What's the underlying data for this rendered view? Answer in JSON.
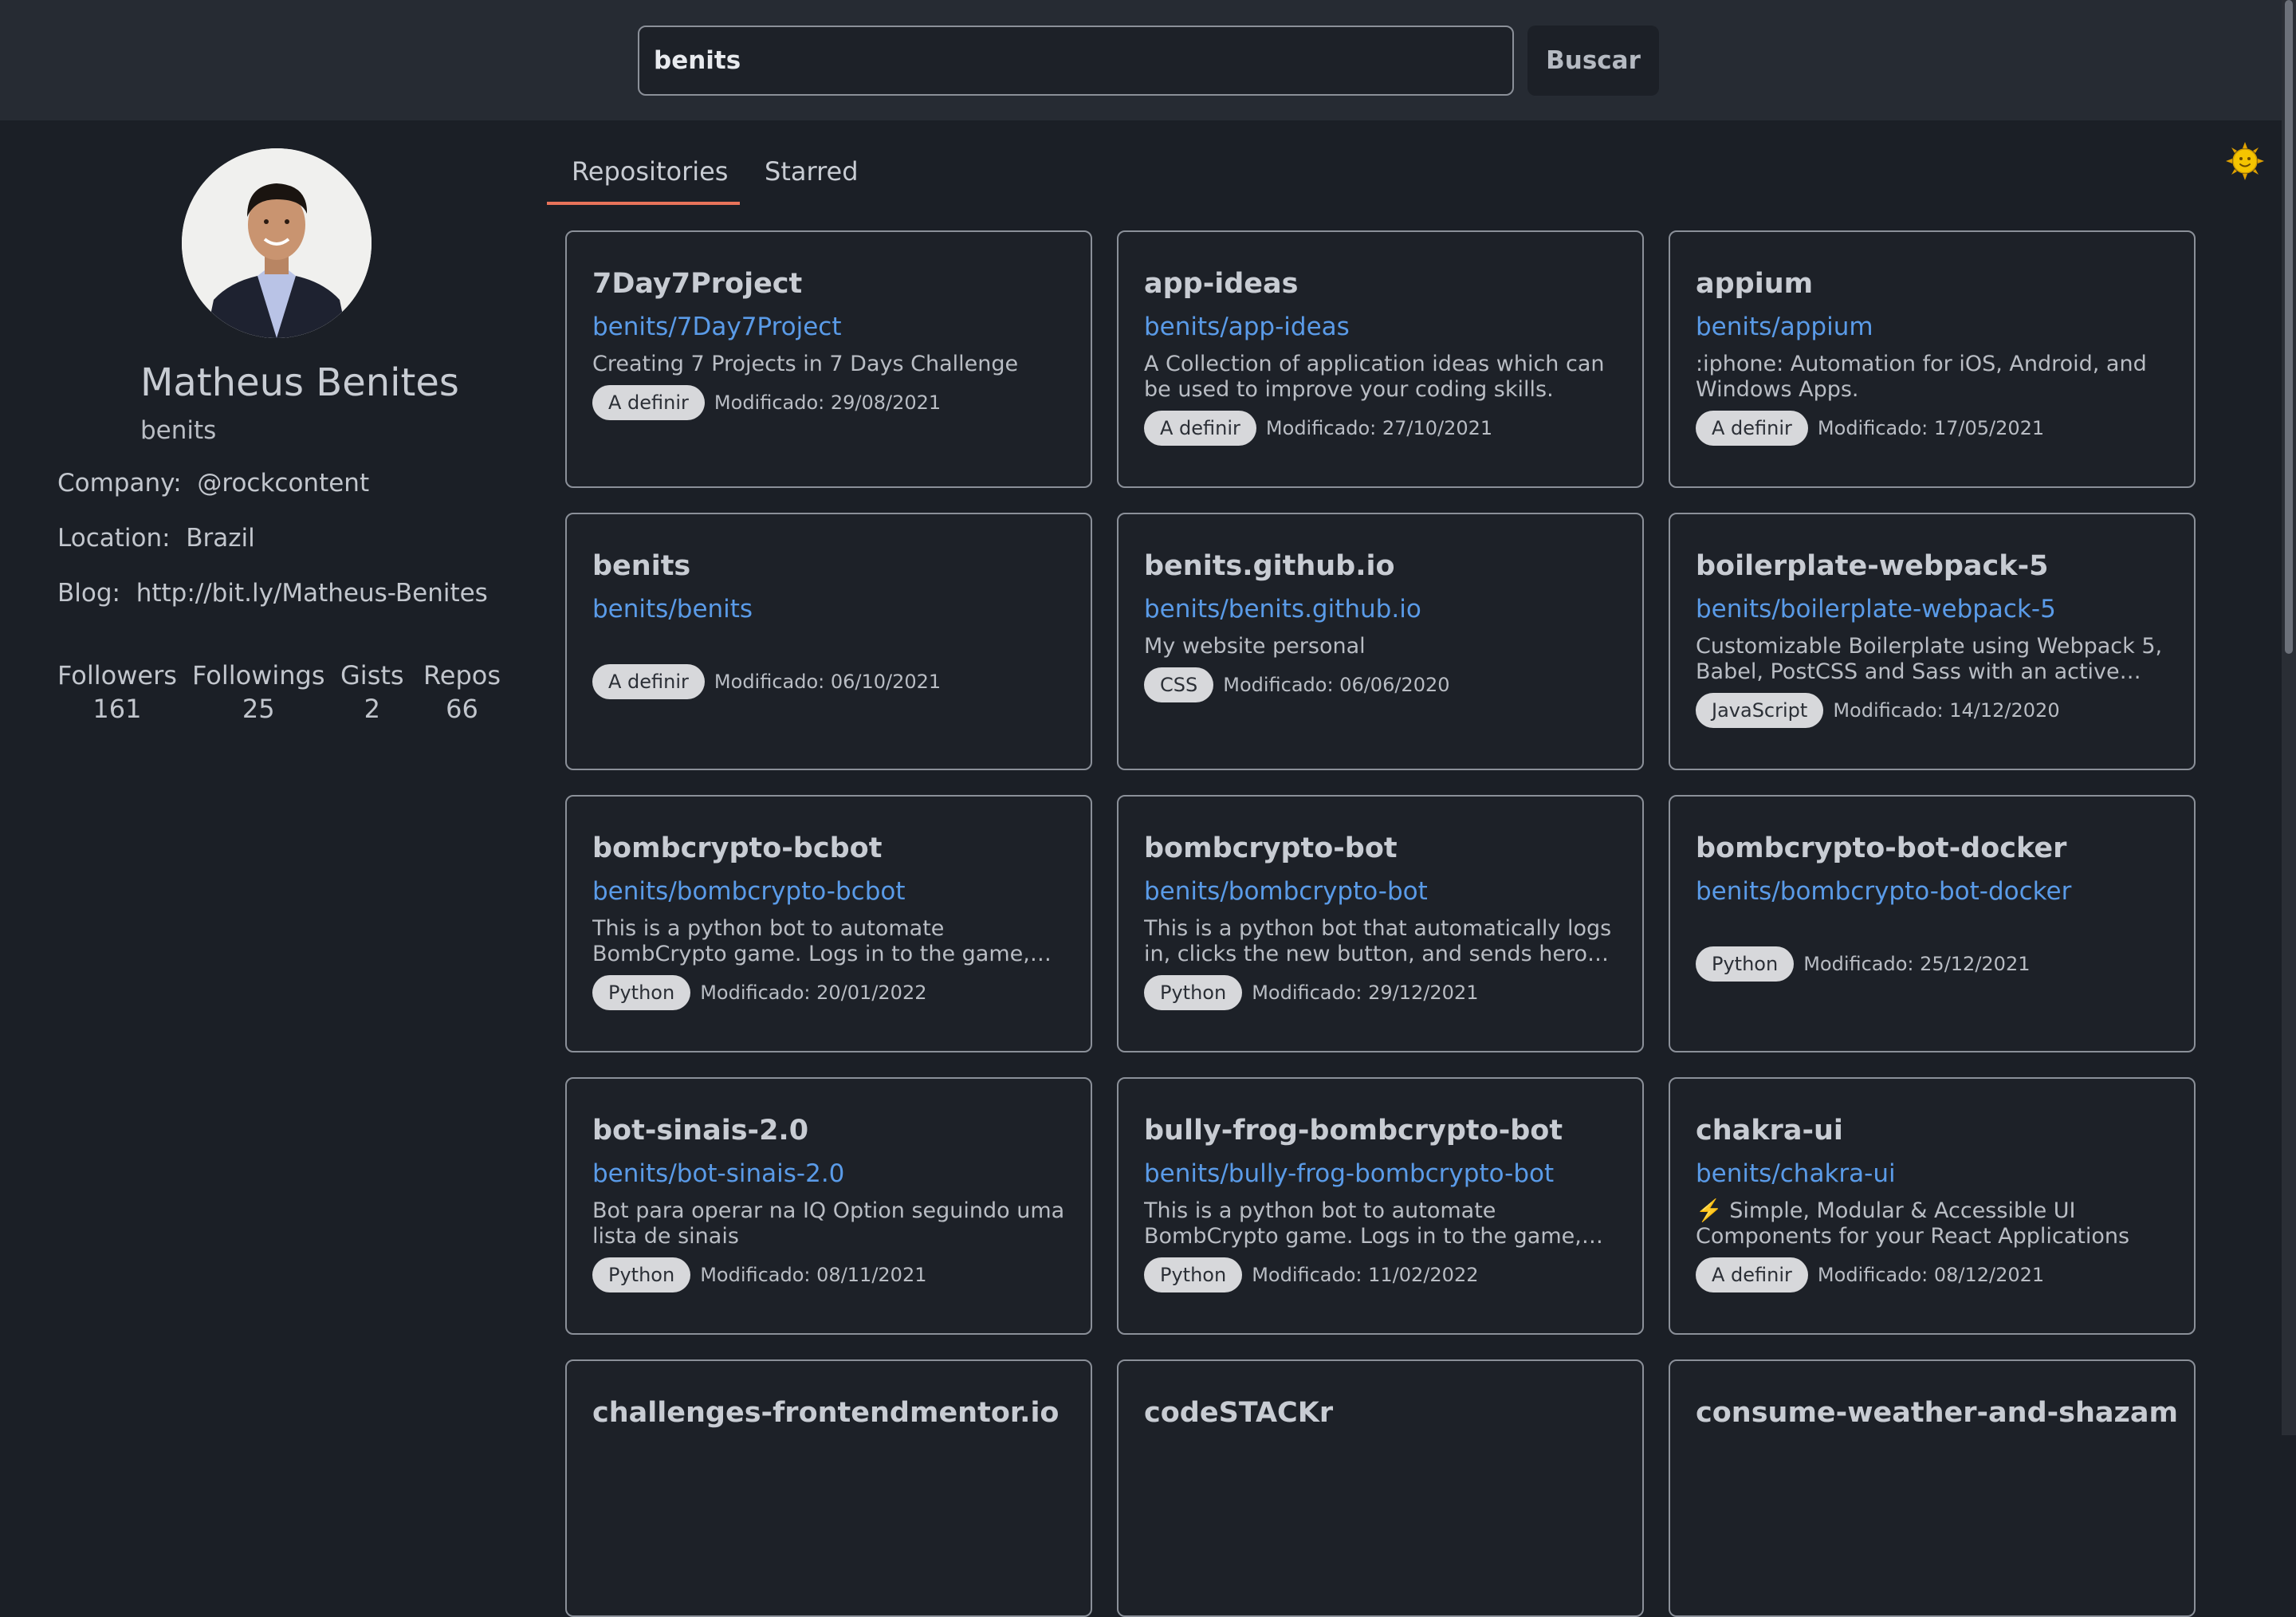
{
  "search": {
    "value": "benits",
    "button_label": "Buscar"
  },
  "theme_toggle": {
    "icon": "sun-face-icon",
    "glyph": "🌞"
  },
  "profile": {
    "name": "Matheus Benites",
    "login": "benits",
    "company_label": "Company:",
    "company": "@rockcontent",
    "location_label": "Location:",
    "location": "Brazil",
    "blog_label": "Blog:",
    "blog": "http://bit.ly/Matheus-Benites",
    "stats": [
      {
        "label": "Followers",
        "value": "161"
      },
      {
        "label": "Followings",
        "value": "25"
      },
      {
        "label": "Gists",
        "value": "2"
      },
      {
        "label": "Repos",
        "value": "66"
      }
    ]
  },
  "tabs": [
    {
      "label": "Repositories",
      "active": true
    },
    {
      "label": "Starred",
      "active": false
    }
  ],
  "repos": [
    {
      "name": "7Day7Project",
      "full_name": "benits/7Day7Project",
      "description": "Creating 7 Projects in 7 Days Challenge",
      "language": "A definir",
      "modified": "Modificado: 29/08/2021"
    },
    {
      "name": "app-ideas",
      "full_name": "benits/app-ideas",
      "description": "A Collection of application ideas which can be used to improve your coding skills.",
      "language": "A definir",
      "modified": "Modificado: 27/10/2021"
    },
    {
      "name": "appium",
      "full_name": "benits/appium",
      "description": ":iphone: Automation for iOS, Android, and Windows Apps.",
      "language": "A definir",
      "modified": "Modificado: 17/05/2021"
    },
    {
      "name": "benits",
      "full_name": "benits/benits",
      "description": "",
      "language": "A definir",
      "modified": "Modificado: 06/10/2021"
    },
    {
      "name": "benits.github.io",
      "full_name": "benits/benits.github.io",
      "description": "My website personal",
      "language": "CSS",
      "modified": "Modificado: 06/06/2020"
    },
    {
      "name": "boilerplate-webpack-5",
      "full_name": "benits/boilerplate-webpack-5",
      "description": "Customizable Boilerplate using Webpack 5, Babel, PostCSS and Sass with an active…",
      "language": "JavaScript",
      "modified": "Modificado: 14/12/2020"
    },
    {
      "name": "bombcrypto-bcbot",
      "full_name": "benits/bombcrypto-bcbot",
      "description": "This is a python bot to automate BombCrypto game. Logs in to the game, reconnects when…",
      "language": "Python",
      "modified": "Modificado: 20/01/2022"
    },
    {
      "name": "bombcrypto-bot",
      "full_name": "benits/bombcrypto-bot",
      "description": "This is a python bot that automatically logs in, clicks the new button, and sends heroes to…",
      "language": "Python",
      "modified": "Modificado: 29/12/2021"
    },
    {
      "name": "bombcrypto-bot-docker",
      "full_name": "benits/bombcrypto-bot-docker",
      "description": "",
      "language": "Python",
      "modified": "Modificado: 25/12/2021"
    },
    {
      "name": "bot-sinais-2.0",
      "full_name": "benits/bot-sinais-2.0",
      "description": "Bot para operar na IQ Option seguindo uma lista de sinais",
      "language": "Python",
      "modified": "Modificado: 08/11/2021"
    },
    {
      "name": "bully-frog-bombcrypto-bot",
      "full_name": "benits/bully-frog-bombcrypto-bot",
      "description": "This is a python bot to automate BombCrypto game. Logs in to the game, reconnects when…",
      "language": "Python",
      "modified": "Modificado: 11/02/2022"
    },
    {
      "name": "chakra-ui",
      "full_name": "benits/chakra-ui",
      "description": "⚡️ Simple, Modular & Accessible UI Components for your React Applications",
      "language": "A definir",
      "modified": "Modificado: 08/12/2021"
    },
    {
      "name": "challenges-frontendmentor.io",
      "full_name": "",
      "description": "",
      "language": "",
      "modified": ""
    },
    {
      "name": "codeSTACKr",
      "full_name": "",
      "description": "",
      "language": "",
      "modified": ""
    },
    {
      "name": "consume-weather-and-shazam",
      "full_name": "",
      "description": "",
      "language": "",
      "modified": ""
    }
  ]
}
